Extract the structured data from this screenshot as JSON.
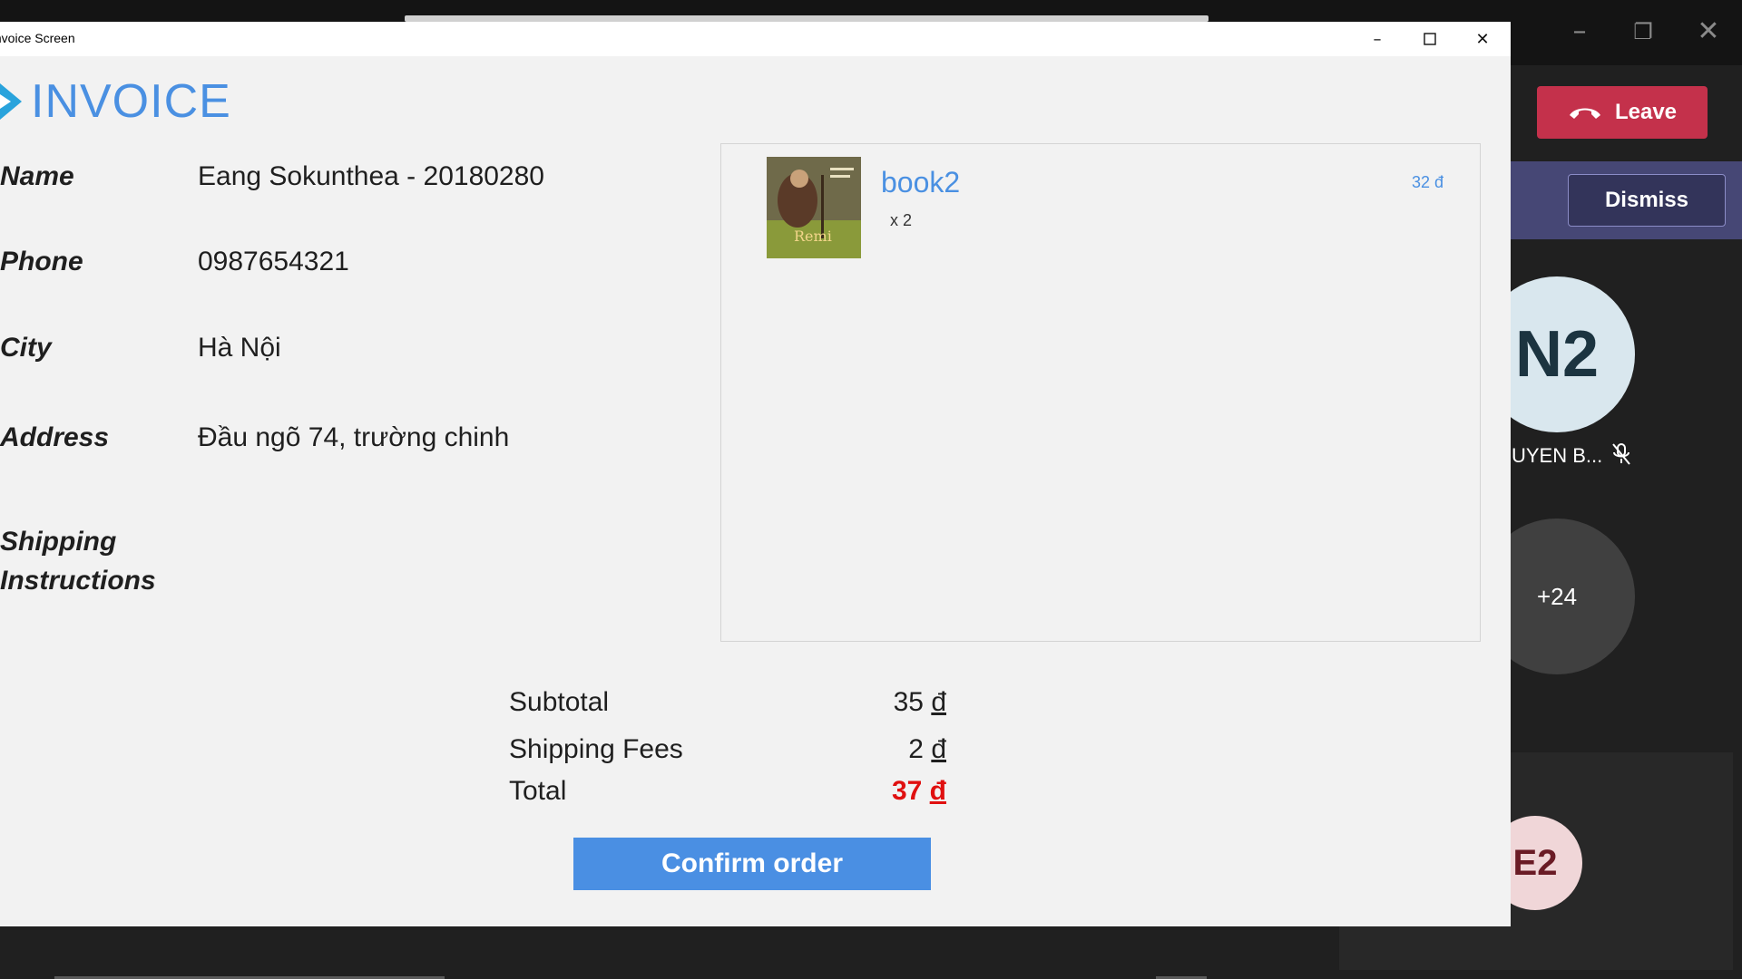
{
  "window": {
    "title": "Invoice Screen"
  },
  "header": {
    "title": "INVOICE"
  },
  "form": {
    "name_label": "Name",
    "name_value": "Eang Sokunthea - 20180280",
    "phone_label": "Phone",
    "phone_value": "0987654321",
    "city_label": "City",
    "city_value": "Hà Nội",
    "address_label": "Address",
    "address_value": "Đầu ngõ 74, trường chinh",
    "shipping_label_line1": "Shipping",
    "shipping_label_line2": "Instructions",
    "shipping_value": ""
  },
  "cart": {
    "items": [
      {
        "title": "book2",
        "quantity": "x  2",
        "price": "32 đ",
        "cover_text": "Remi"
      }
    ]
  },
  "summary": {
    "subtotal_label": "Subtotal",
    "subtotal_value": "35",
    "shipping_label": "Shipping Fees",
    "shipping_value": "2",
    "total_label": "Total",
    "total_value": "37",
    "currency": "đ"
  },
  "actions": {
    "confirm_label": "Confirm order"
  },
  "meeting": {
    "leave_label": "Leave",
    "dismiss_label": "Dismiss",
    "participant_initials": "N2",
    "participant_name": "UYEN B...",
    "more_count": "+24",
    "other_initials": "E2"
  },
  "colors": {
    "accent": "#4a90e2",
    "total": "#e01010",
    "leave": "#c4314b",
    "notification": "#464775"
  }
}
